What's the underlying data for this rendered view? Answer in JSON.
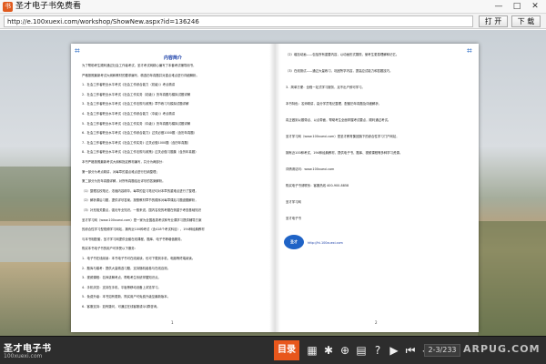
{
  "window": {
    "title": "圣才电子书免费看",
    "min_glyph": "—",
    "max_glyph": "□",
    "close_glyph": "✕"
  },
  "address_bar": {
    "url": "http://e.100xuexi.com/workshop/ShowNew.aspx?id=136246",
    "open_label": "打 开",
    "download_label": "下 载"
  },
  "book": {
    "left_page": {
      "title": "内容简介",
      "lines": [
        "为了帮助考生顺利通过社会工作者考试，圣才考试网精心编写了本套考试辅导用书，",
        "严格按照最新考试大纲和教材的要求编写，精选历年真题并对重点难点进行详细解析。",
        "1．社会工作者职业水平考试《社会工作综合能力（初级）》考点精讲",
        "2．社会工作者职业水平考试《社会工作实务（初级）》历年真题与模拟试题详解",
        "3．社会工作者职业水平考试《社会工作法规与政策》章节练习与模拟试题详解",
        "4．社会工作者职业水平考试《社会工作综合能力（中级）》考点精讲",
        "5．社会工作者职业水平考试《社会工作实务（中级）》历年真题与模拟试题详解",
        "6．社会工作者职业水平考试《社会工作综合能力》过关必做1000题（含历年真题）",
        "7．社会工作者职业水平考试《社会工作实务》过关必做1000题（含历年真题）",
        "8．社会工作者职业水平考试《社会工作法规与政策》过关必做习题集（含历年真题）",
        "本书严格按照最新考试大纲和指定教材编写，共分为两部分：",
        "第一部分为考点精讲，对每章的重点难点进行归纳整理；",
        "第二部分为历年真题详解，对所有真题给出详尽的答案解析。",
        "（1）整理名校笔记，浓缩内容精华。每章的复习笔记均对本章的重难点进行了整理，",
        "（2）解析课后习题，提供详尽答案。按照教材章节的顺序对每章课后习题逐题解析，",
        "（3）补充相关要点，强化专业知识。一般来说，国内名校的考题在侧重于考查基础知识",
        "圣才学习网（www.100xuexi.com）是一家为全国各类考试和专业课学习提供辅导方案",
        "的综合性学习型视频学习网站，拥有近100种考试（含418个考试科目）、194种经典教材",
        "与本书相配套，圣才学习网提供全套在线课程、题库、电子书等增值服务。",
        "购买本书电子书的用户可享受以下服务：",
        "1．电子书在线阅读：本书电子书可在线阅读，也可下载到手机、电脑等终端阅读。",
        "2．题库与模考：提供大量精选习题，支持随机组卷与在线自测。",
        "3．视频课程：名师讲解考点，帮助考生系统掌握知识点。",
        "4．手机浏览：支持在手机、平板等移动设备上浏览学习。",
        "5．免费升级：本书如有更新，购买用户可免费升级至最新版本。",
        "6．客服支持：如有疑问，可通过在线客服或QQ群咨询。"
      ],
      "page_number": "1"
    },
    "right_page": {
      "lines": [
        "（2）增加动画——包括所有重要内容，以动画形式展现，使考生更易理解和记忆。",
        "（3）在线测试——通过大量练习，巩固所学内容，提高应试能力和答题技巧。",
        "3．简单方便：全程一站式学习服务，足不出户即可学习。",
        "本书特色：名师精讲，高分学员笔记整理，配套历年真题及详细解析，",
        "真正做到以题带点、以点带面，帮助考生全面掌握考试要点，顺利通过考试。",
        "圣才学习网（www.100xuexi.com）是圣才教育集团旗下的综合性学习门户网站，",
        "拥有近100种考试、194种经典教材，提供电子书、题库、视频课程等多种学习资源。",
        "详情请访问：www.100xuexi.com",
        "购买电子书请联系：客服热线 400-900-8858",
        "圣才学习网",
        "圣才电子书"
      ],
      "site_link": "http://ht.100xuexi.com",
      "page_number": "2"
    }
  },
  "toolbar": {
    "brand_name": "圣才电子书",
    "brand_url": "100xuexi.com",
    "toc_label": "目录",
    "icons": [
      {
        "name": "thumbnails-icon",
        "glyph": "▦"
      },
      {
        "name": "settings-icon",
        "glyph": "✱"
      },
      {
        "name": "zoom-icon",
        "glyph": "⊕"
      },
      {
        "name": "layout-icon",
        "glyph": "▤"
      },
      {
        "name": "help-icon",
        "glyph": "?"
      },
      {
        "name": "play-icon",
        "glyph": "▶"
      },
      {
        "name": "first-page-icon",
        "glyph": "⏮"
      },
      {
        "name": "prev-page-icon",
        "glyph": "◀"
      }
    ],
    "page_indicator": "2-3/233",
    "watermark": "ARPUG.COM"
  },
  "colors": {
    "accent": "#e8571c",
    "link_blue": "#1a3fa8",
    "toolbar_bg": "#2d2d2d"
  }
}
